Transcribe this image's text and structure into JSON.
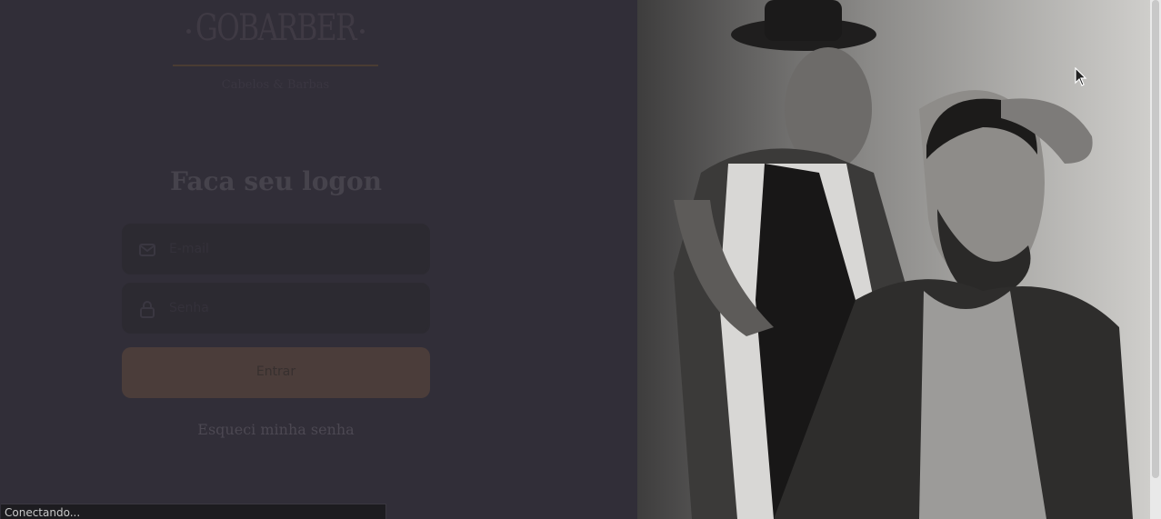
{
  "brand": {
    "name": "GOBARBER",
    "tagline": "Cabelos & Barbas"
  },
  "login": {
    "title": "Faca seu logon",
    "email_placeholder": "E-mail",
    "password_placeholder": "Senha",
    "submit_label": "Entrar",
    "forgot_label": "Esqueci minha senha"
  },
  "statusbar": {
    "text": "Conectando..."
  },
  "icons": [
    "mail-icon",
    "lock-icon",
    "mouse-cursor-icon"
  ],
  "colors": {
    "background": "#312e38",
    "button": "#4b3d3a",
    "accent": "#ff9000"
  }
}
